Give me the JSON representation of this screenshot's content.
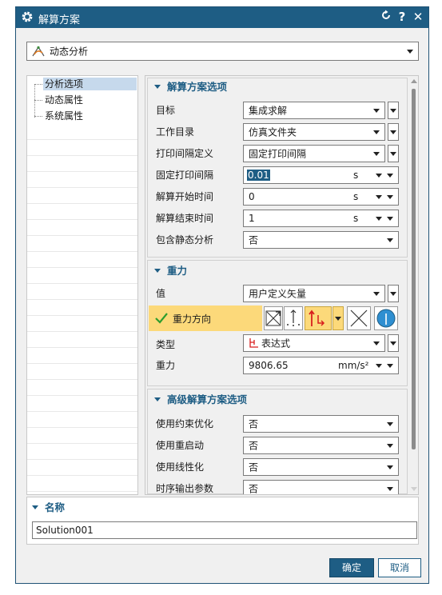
{
  "window": {
    "title": "解算方案",
    "refresh_icon": "reset-icon",
    "help_icon": "help-icon",
    "close_icon": "close-icon"
  },
  "solution_type": {
    "value": "动态分析",
    "icon": "dynamic-analysis-icon"
  },
  "tree": {
    "items": [
      {
        "label": "分析选项",
        "selected": true
      },
      {
        "label": "动态属性",
        "selected": false
      },
      {
        "label": "系统属性",
        "selected": false
      }
    ]
  },
  "solution_options": {
    "header": "解算方案选项",
    "rows": [
      {
        "label": "目标",
        "value": "集成求解"
      },
      {
        "label": "工作目录",
        "value": "仿真文件夹"
      },
      {
        "label": "打印间隔定义",
        "value": "固定打印间隔"
      },
      {
        "label": "固定打印间隔",
        "value": "0.01",
        "unit": "s"
      },
      {
        "label": "解算开始时间",
        "value": "0",
        "unit": "s"
      },
      {
        "label": "解算结束时间",
        "value": "1",
        "unit": "s"
      },
      {
        "label": "包含静态分析",
        "value": "否"
      }
    ]
  },
  "gravity": {
    "header": "重力",
    "value_label": "值",
    "value": "用户定义矢量",
    "direction_label": "重力方向",
    "type_label": "类型",
    "type_value": "表达式",
    "magnitude_label": "重力",
    "magnitude_value": "9806.65",
    "magnitude_unit": "mm/s²"
  },
  "advanced": {
    "header": "高级解算方案选项",
    "rows": [
      {
        "label": "使用约束优化",
        "value": "否"
      },
      {
        "label": "使用重启动",
        "value": "否"
      },
      {
        "label": "使用线性化",
        "value": "否"
      },
      {
        "label": "时序输出参数",
        "value": "否"
      }
    ]
  },
  "name_section": {
    "header": "名称",
    "value": "Solution001"
  },
  "buttons": {
    "ok": "确定",
    "cancel": "取消"
  },
  "colors": {
    "title_bar": "#1e5d84",
    "accent": "#1e5d84",
    "highlight": "#fcd97a",
    "tree_selection": "#c6d9ec",
    "check": "#2e9d2e",
    "vector_red": "#d81e1e"
  }
}
